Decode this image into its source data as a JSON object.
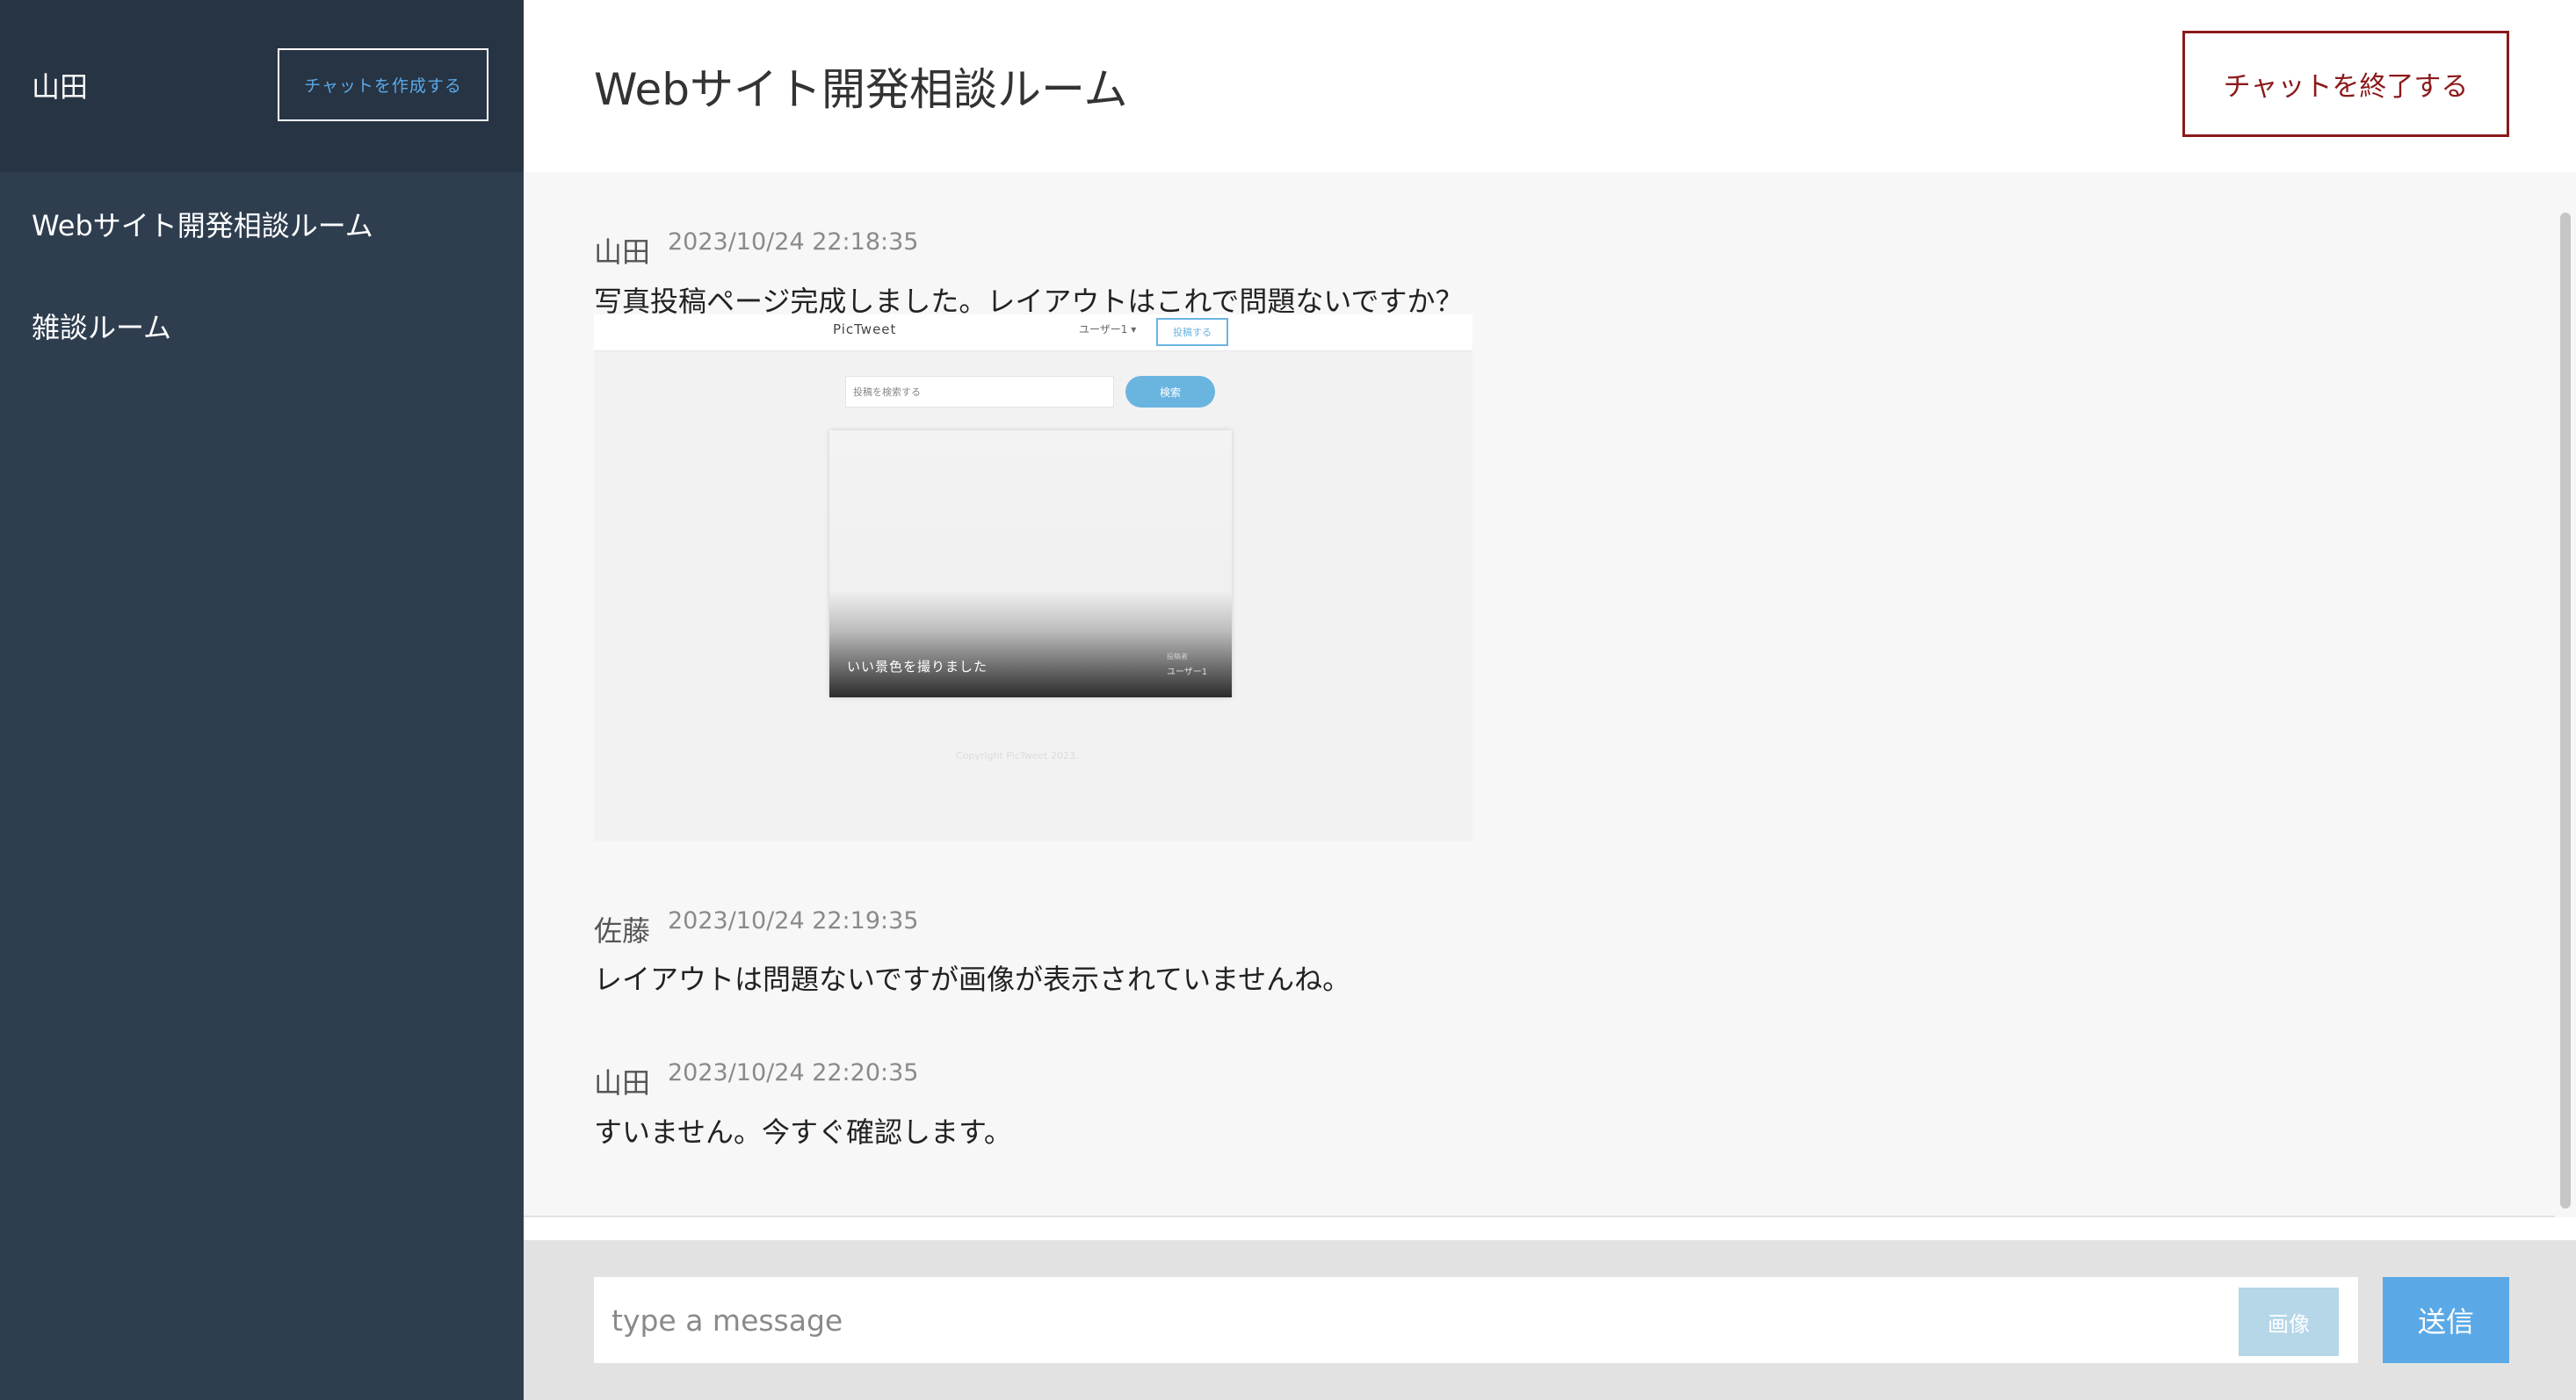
{
  "sidebar": {
    "user_name": "山田",
    "create_chat_label": "チャットを作成する",
    "rooms": [
      {
        "label": "Webサイト開発相談ルーム"
      },
      {
        "label": "雑談ルーム"
      }
    ]
  },
  "header": {
    "room_title": "Webサイト開発相談ルーム",
    "end_chat_label": "チャットを終了する"
  },
  "messages": [
    {
      "name": "山田",
      "time": "2023/10/24 22:18:35",
      "text": "写真投稿ページ完成しました。レイアウトはこれで問題ないですか？",
      "image": {
        "logo": "PicTweet",
        "user_menu": "ユーザー1 ▾",
        "post_button": "投稿する",
        "search_placeholder": "投稿を検索する",
        "search_button": "検索",
        "card_caption": "いい景色を撮りました",
        "poster_label": "投稿者",
        "poster_name": "ユーザー1",
        "copyright": "Copyright PicTweet 2023."
      }
    },
    {
      "name": "佐藤",
      "time": "2023/10/24 22:19:35",
      "text": "レイアウトは問題ないですが画像が表示されていませんね。"
    },
    {
      "name": "山田",
      "time": "2023/10/24 22:20:35",
      "text": "すいません。今すぐ確認します。"
    }
  ],
  "composer": {
    "placeholder": "type a message",
    "image_button_label": "画像",
    "send_button_label": "送信"
  },
  "colors": {
    "sidebar_bg": "#2f3e4f",
    "sidebar_header_bg": "#273444",
    "accent_blue": "#5aa9e6",
    "end_button": "#8b1a1a"
  }
}
